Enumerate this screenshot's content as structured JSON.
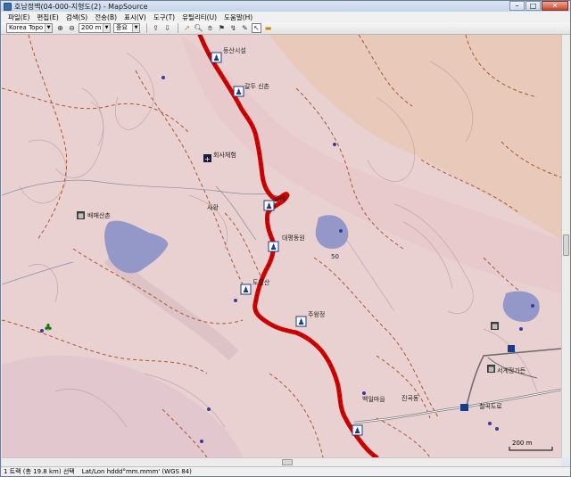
{
  "window": {
    "title": "호남정맥(04-000-지형도(2) - MapSource",
    "controls": {
      "minimize": "–",
      "maximize": "□",
      "close": "✕"
    }
  },
  "menu": [
    {
      "label": "파일(E)"
    },
    {
      "label": "편집(E)"
    },
    {
      "label": "검색(S)"
    },
    {
      "label": "전송(B)"
    },
    {
      "label": "표시(V)"
    },
    {
      "label": "도구(T)"
    },
    {
      "label": "유틸리티(U)"
    },
    {
      "label": "도움말(H)"
    }
  ],
  "toolbar": {
    "map_product": "Korea Topo v9",
    "zoom_level": "200 m",
    "detail": "중요"
  },
  "map": {
    "labels": [
      {
        "id": "l1",
        "text": "등산시설"
      },
      {
        "id": "l2",
        "text": "갈두 신촌"
      },
      {
        "id": "l3",
        "text": "갈래"
      },
      {
        "id": "l4",
        "text": "대평동원"
      },
      {
        "id": "l5",
        "text": "도암산"
      },
      {
        "id": "l6",
        "text": "주왕정"
      },
      {
        "id": "l7",
        "text": "백일마을"
      },
      {
        "id": "l8",
        "text": "서계정가든"
      },
      {
        "id": "l9",
        "text": "사황"
      },
      {
        "id": "l10",
        "text": "진곡동"
      },
      {
        "id": "l11",
        "text": "배매산촌"
      },
      {
        "id": "l12",
        "text": "회사체험"
      },
      {
        "id": "l13",
        "text": "칠곡도로"
      },
      {
        "id": "l14",
        "text": "50"
      }
    ],
    "scale_label": "200 m"
  },
  "status": {
    "selection": "1 트랙 (총 19.8 km) 선택",
    "coords": "Lat/Lon hddd°mm.mmm' (WGS 84)"
  },
  "colors": {
    "map_bg": "#ead1d1",
    "route": "#d10000",
    "water": "#9498c8",
    "contour": "#a8572e"
  }
}
